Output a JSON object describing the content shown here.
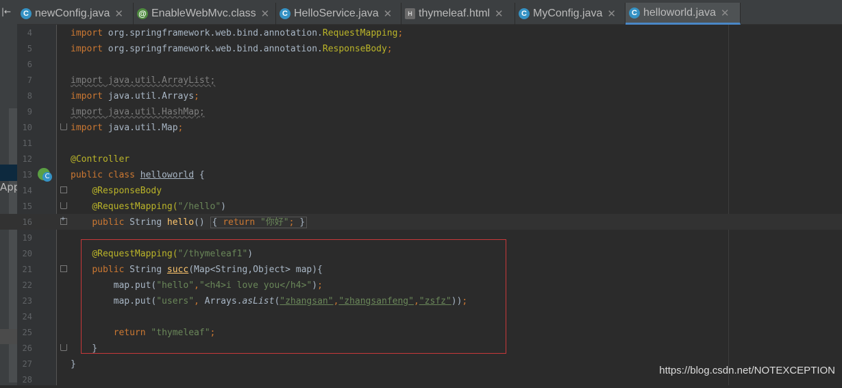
{
  "left_panel": {
    "top_button": "|←",
    "app_label": "App"
  },
  "tabs": [
    {
      "label": "newConfig.java",
      "icon": "class-icon",
      "active": false
    },
    {
      "label": "EnableWebMvc.class",
      "icon": "annotation-icon",
      "active": false
    },
    {
      "label": "HelloService.java",
      "icon": "class-icon",
      "active": false
    },
    {
      "label": "thymeleaf.html",
      "icon": "html-file-icon",
      "active": false
    },
    {
      "label": "MyConfig.java",
      "icon": "class-icon",
      "active": false
    },
    {
      "label": "helloworld.java",
      "icon": "class-icon",
      "active": true
    }
  ],
  "line_numbers": [
    "4",
    "5",
    "6",
    "7",
    "8",
    "9",
    "10",
    "11",
    "12",
    "13",
    "14",
    "15",
    "16",
    "19",
    "20",
    "21",
    "22",
    "23",
    "24",
    "25",
    "26",
    "27",
    "28"
  ],
  "code": {
    "l4": "org.springframework.web.bind.annotation.",
    "l4_cls": "RequestMapping",
    "l5": "org.springframework.web.bind.annotation.",
    "l5_cls": "ResponseBody",
    "l7": "import java.util.ArrayList;",
    "l8_a": "java.util.Arrays",
    "l9": "import java.util.HashMap;",
    "l10_a": "java.util.Map",
    "l12": "@Controller",
    "l13_cls": "helloworld",
    "l14": "@ResponseBody",
    "l15_ann": "@RequestMapping(",
    "l15_str": "\"/hello\"",
    "l16_str": "\"你好\"",
    "l20_ann": "@RequestMapping(",
    "l20_str": "\"/thymeleaf1\"",
    "l21_fn": "succ",
    "l21_rest": "(Map<String,Object> map){",
    "l22_str1": "\"hello\"",
    "l22_str2": "\"<h4>i love you</h4>\"",
    "l23_str1": "\"users\"",
    "l23_s1": "\"zhangsan\"",
    "l23_s2": "\"zhangsanfeng\"",
    "l23_s3": "\"zsfz\"",
    "l25_str": "\"thymeleaf\""
  },
  "watermark": "https://blog.csdn.net/NOTEXCEPTION",
  "colors": {
    "keyword": "#cc7832",
    "string": "#6a8759",
    "annotation": "#bbb529",
    "highlight_box": "#c9383a"
  }
}
